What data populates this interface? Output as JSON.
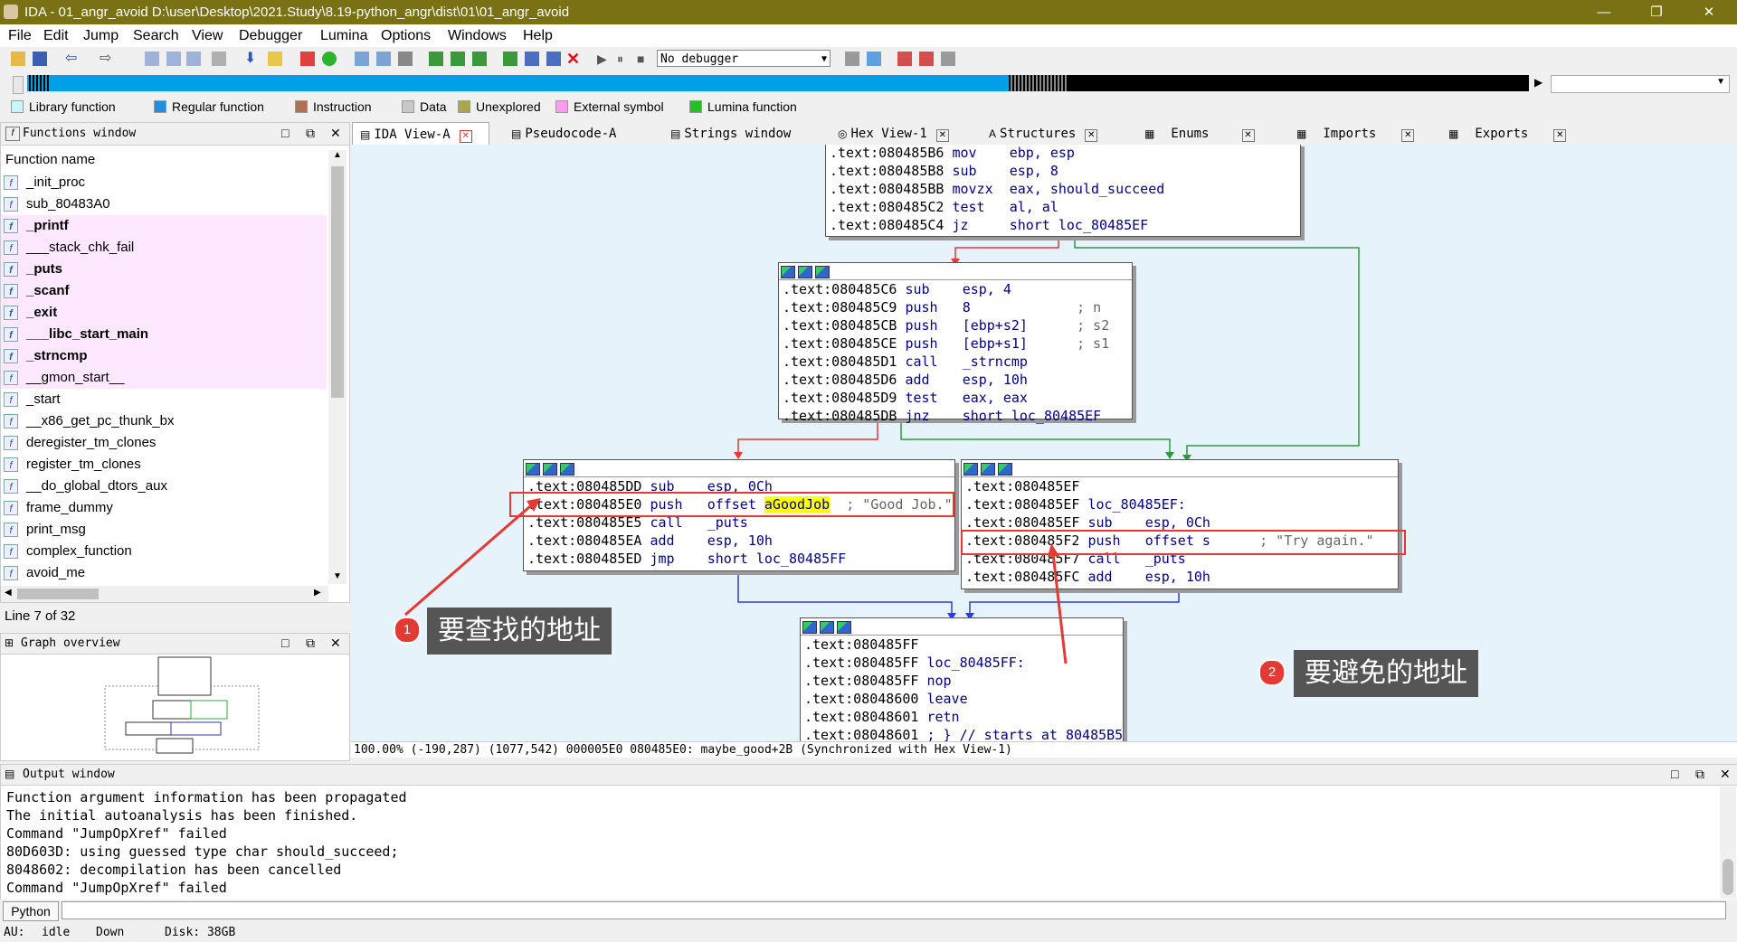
{
  "window": {
    "title": "IDA - 01_angr_avoid D:\\user\\Desktop\\2021.Study\\8.19-python_angr\\dist\\01\\01_angr_avoid",
    "minimize": "—",
    "maximize": "❐",
    "close": "✕"
  },
  "menu": [
    "File",
    "Edit",
    "Jump",
    "Search",
    "View",
    "Debugger",
    "Lumina",
    "Options",
    "Windows",
    "Help"
  ],
  "toolbar": {
    "debugger_select": "No debugger"
  },
  "legend": [
    {
      "label": "Library function",
      "color": "#c9f6fa"
    },
    {
      "label": "Regular function",
      "color": "#1e90e0"
    },
    {
      "label": "Instruction",
      "color": "#b07050"
    },
    {
      "label": "Data",
      "color": "#c8c8c8"
    },
    {
      "label": "Unexplored",
      "color": "#a8a84a"
    },
    {
      "label": "External symbol",
      "color": "#ff9af0"
    },
    {
      "label": "Lumina function",
      "color": "#22c022"
    }
  ],
  "functions_window": {
    "title": "Functions window",
    "column": "Function name",
    "items": [
      {
        "name": "_init_proc",
        "lib": false,
        "bold": false
      },
      {
        "name": "sub_80483A0",
        "lib": false,
        "bold": false
      },
      {
        "name": "_printf",
        "lib": true,
        "bold": true
      },
      {
        "name": "___stack_chk_fail",
        "lib": true,
        "bold": false
      },
      {
        "name": "_puts",
        "lib": true,
        "bold": true
      },
      {
        "name": "_scanf",
        "lib": true,
        "bold": true
      },
      {
        "name": "_exit",
        "lib": true,
        "bold": true
      },
      {
        "name": "___libc_start_main",
        "lib": true,
        "bold": true
      },
      {
        "name": "_strncmp",
        "lib": true,
        "bold": true
      },
      {
        "name": "__gmon_start__",
        "lib": true,
        "bold": false
      },
      {
        "name": "_start",
        "lib": false,
        "bold": false
      },
      {
        "name": "__x86_get_pc_thunk_bx",
        "lib": false,
        "bold": false
      },
      {
        "name": "deregister_tm_clones",
        "lib": false,
        "bold": false
      },
      {
        "name": "register_tm_clones",
        "lib": false,
        "bold": false
      },
      {
        "name": "__do_global_dtors_aux",
        "lib": false,
        "bold": false
      },
      {
        "name": "frame_dummy",
        "lib": false,
        "bold": false
      },
      {
        "name": "print_msg",
        "lib": false,
        "bold": false
      },
      {
        "name": "complex_function",
        "lib": false,
        "bold": false
      },
      {
        "name": "avoid_me",
        "lib": false,
        "bold": false
      }
    ],
    "line_info": "Line 7 of 32"
  },
  "graph_overview": {
    "title": "Graph overview"
  },
  "tabs": [
    {
      "label": "IDA View-A",
      "active": true
    },
    {
      "label": "Pseudocode-A",
      "active": false
    },
    {
      "label": "Strings window",
      "active": false
    },
    {
      "label": "Hex View-1",
      "active": false
    },
    {
      "label": "Structures",
      "active": false
    },
    {
      "label": "Enums",
      "active": false
    },
    {
      "label": "Imports",
      "active": false
    },
    {
      "label": "Exports",
      "active": false
    }
  ],
  "graph": {
    "nodes": [
      {
        "lines": [
          [
            ".text:080485B6",
            "mov",
            "ebp, esp",
            ""
          ],
          [
            ".text:080485B8",
            "sub",
            "esp, 8",
            ""
          ],
          [
            ".text:080485BB",
            "movzx",
            "eax, should_succeed",
            ""
          ],
          [
            ".text:080485C2",
            "test",
            "al, al",
            ""
          ],
          [
            ".text:080485C4",
            "jz",
            "short loc_80485EF",
            ""
          ]
        ]
      },
      {
        "lines": [
          [
            ".text:080485C6",
            "sub",
            "esp, 4",
            ""
          ],
          [
            ".text:080485C9",
            "push",
            "8",
            "; n"
          ],
          [
            ".text:080485CB",
            "push",
            "[ebp+s2]",
            "; s2"
          ],
          [
            ".text:080485CE",
            "push",
            "[ebp+s1]",
            "; s1"
          ],
          [
            ".text:080485D1",
            "call",
            "_strncmp",
            ""
          ],
          [
            ".text:080485D6",
            "add",
            "esp, 10h",
            ""
          ],
          [
            ".text:080485D9",
            "test",
            "eax, eax",
            ""
          ],
          [
            ".text:080485DB",
            "jnz",
            "short loc_80485EF",
            ""
          ]
        ]
      },
      {
        "lines": [
          [
            ".text:080485DD",
            "sub",
            "esp, 0Ch",
            ""
          ],
          [
            ".text:080485E0",
            "push",
            "offset aGoodJob",
            "; \"Good Job.\""
          ],
          [
            ".text:080485E5",
            "call",
            "_puts",
            ""
          ],
          [
            ".text:080485EA",
            "add",
            "esp, 10h",
            ""
          ],
          [
            ".text:080485ED",
            "jmp",
            "short loc_80485FF",
            ""
          ]
        ]
      },
      {
        "lines": [
          [
            ".text:080485EF",
            "",
            "",
            ""
          ],
          [
            ".text:080485EF",
            "loc_80485EF:",
            "",
            ""
          ],
          [
            ".text:080485EF",
            "sub",
            "esp, 0Ch",
            ""
          ],
          [
            ".text:080485F2",
            "push",
            "offset s",
            "; \"Try again.\""
          ],
          [
            ".text:080485F7",
            "call",
            "_puts",
            ""
          ],
          [
            ".text:080485FC",
            "add",
            "esp, 10h",
            ""
          ]
        ]
      },
      {
        "lines": [
          [
            ".text:080485FF",
            "",
            "",
            ""
          ],
          [
            ".text:080485FF",
            "loc_80485FF:",
            "",
            ""
          ],
          [
            ".text:080485FF",
            "nop",
            "",
            ""
          ],
          [
            ".text:08048600",
            "leave",
            "",
            ""
          ],
          [
            ".text:08048601",
            "retn",
            "",
            ""
          ],
          [
            ".text:08048601",
            "; } // starts at 80485B5",
            "",
            ""
          ]
        ]
      }
    ],
    "status": "100.00% (-190,287) (1077,542) 000005E0 080485E0: maybe_good+2B (Synchronized with Hex View-1)"
  },
  "annotations": [
    {
      "num": "1",
      "text": "要查找的地址"
    },
    {
      "num": "2",
      "text": "要避免的地址"
    }
  ],
  "output_window": {
    "title": "Output window",
    "lines": [
      "Function argument information has been propagated",
      "The initial autoanalysis has been finished.",
      "Command \"JumpOpXref\" failed",
      "80D603D: using guessed type char should_succeed;",
      "8048602: decompilation has been cancelled",
      "Command \"JumpOpXref\" failed"
    ]
  },
  "python_button": "Python",
  "statusbar": {
    "au": "AU:",
    "state": "idle",
    "dir": "Down",
    "disk": "Disk: 38GB"
  }
}
